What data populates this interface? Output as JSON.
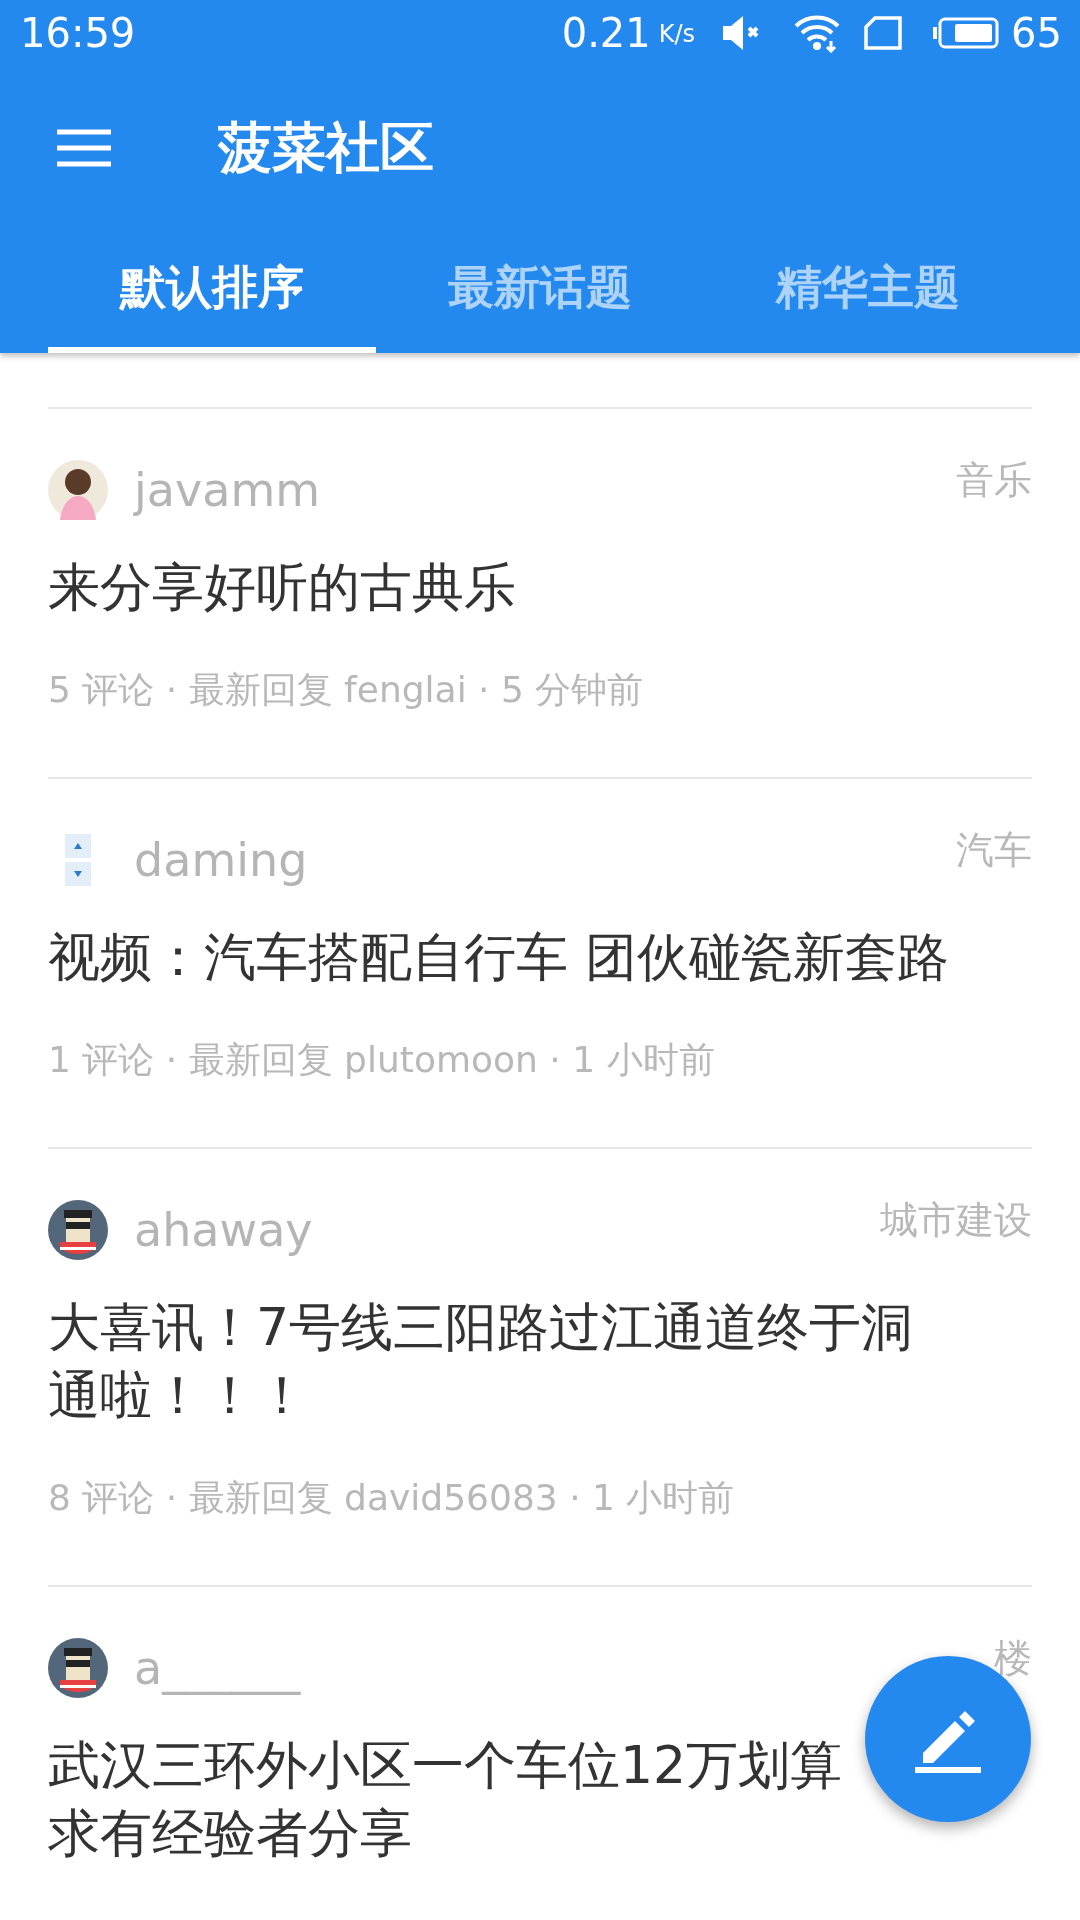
{
  "status_bar": {
    "time": "16:59",
    "speed": "0.21",
    "speed_unit": "K/s",
    "battery": "65"
  },
  "toolbar": {
    "title": "菠菜社区"
  },
  "tabs": [
    {
      "label": "默认排序",
      "selected": true
    },
    {
      "label": "最新话题",
      "selected": false
    },
    {
      "label": "精华主题",
      "selected": false
    }
  ],
  "posts": [
    {
      "kind": "portrait",
      "user": "javamm",
      "category": "音乐",
      "title_lines": [
        "来分享好听的古典乐"
      ],
      "meta": "5 评论 · 最新回复 fenglai · 5 分钟前"
    },
    {
      "kind": "arrows",
      "user": "daming",
      "category": "汽车",
      "title_lines": [
        "视频：汽车搭配自行车 团伙碰瓷新套路"
      ],
      "meta": "1 评论 · 最新回复 plutomoon · 1 小时前"
    },
    {
      "kind": "pixel",
      "user": "ahaway",
      "category": "城市建设",
      "title_lines": [
        "大喜讯！7号线三阳路过江通道终于洞",
        "通啦！！！"
      ],
      "meta": "8 评论 · 最新回复 david56083 · 1 小时前"
    },
    {
      "kind": "pixel",
      "user": "a______",
      "category": "楼",
      "title_lines": [
        "武汉三环外小区一个车位12万划算",
        "求有经验者分享"
      ]
    }
  ]
}
